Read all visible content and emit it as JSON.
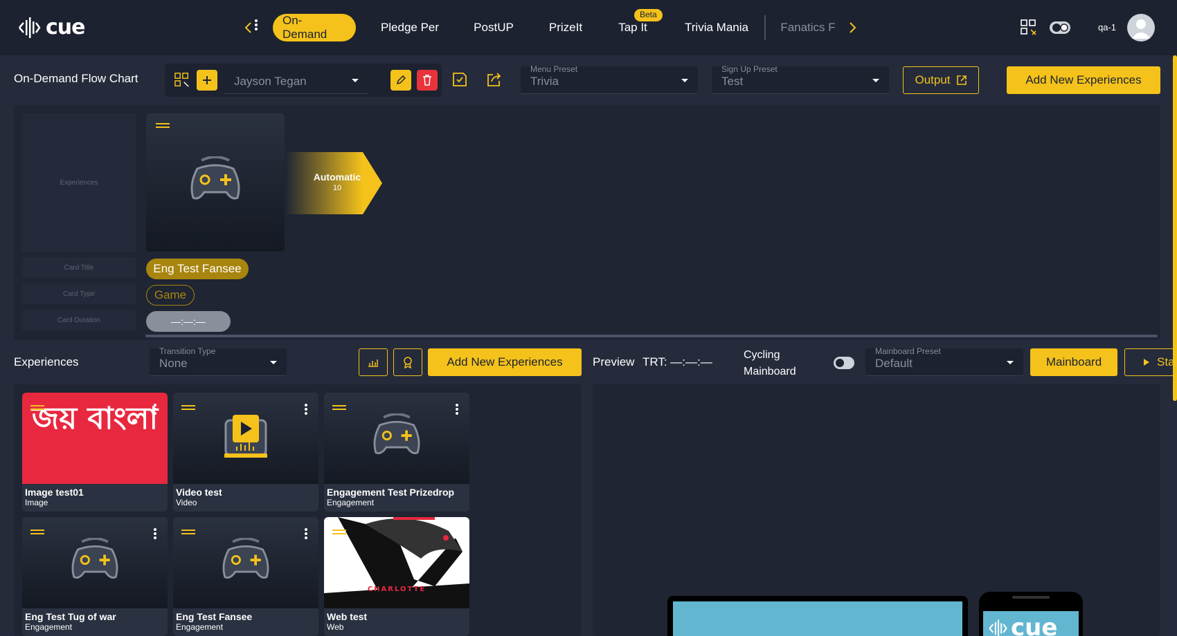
{
  "nav": {
    "logo_text": "cue",
    "tabs": [
      "On-Demand",
      "Pledge Per",
      "PostUP",
      "PrizeIt",
      "Tap It",
      "Trivia Mania",
      "Fanatics F"
    ],
    "active_tab": "On-Demand",
    "beta_badge": "Beta",
    "user": "qa-1"
  },
  "toolbar": {
    "title": "On-Demand Flow Chart",
    "flow_select": "Jayson Tegan",
    "menu_preset_label": "Menu Preset",
    "menu_preset_value": "Trivia",
    "signup_preset_label": "Sign Up Preset",
    "signup_preset_value": "Test",
    "output_label": "Output",
    "add_new_label": "Add New Experiences"
  },
  "flow": {
    "legend": [
      "Experiences",
      "Card Title",
      "Card Type",
      "Card Duration"
    ],
    "card": {
      "title": "Eng Test Fansee",
      "type": "Game",
      "duration": "—:—:—"
    },
    "transition": {
      "label": "Automatic",
      "value": "10"
    }
  },
  "experiences": {
    "title": "Experiences",
    "transition_label": "Transition Type",
    "transition_value": "None",
    "add_new_label": "Add New Experiences",
    "preview_label": "Preview",
    "trt_label": "TRT: —:—:—",
    "cycling_label": "Cycling Mainboard",
    "mainboard_preset_label": "Mainboard Preset",
    "mainboard_preset_value": "Default",
    "mainboard_label": "Mainboard",
    "start_label": "Sta",
    "cards": [
      {
        "title": "Image test01",
        "type": "Image",
        "thumb": "joy-bangla-image",
        "thumb_text": "জয় বাংলা"
      },
      {
        "title": "Video test",
        "type": "Video",
        "thumb": "video-icon"
      },
      {
        "title": "Engagement Test Prizedrop",
        "type": "Engagement",
        "thumb": "gamepad-icon"
      },
      {
        "title": "Eng Test Tug of war",
        "type": "Engagement",
        "thumb": "gamepad-icon"
      },
      {
        "title": "Eng Test Fansee",
        "type": "Engagement",
        "thumb": "gamepad-icon"
      },
      {
        "title": "Web test",
        "type": "Web",
        "thumb": "charlotte-logo",
        "thumb_text": "CHARLOTTE"
      }
    ]
  },
  "preview": {
    "phone_logo": "cue"
  },
  "colors": {
    "accent": "#f4c21b",
    "bg": "#252b3b",
    "panel": "#1f2533",
    "danger": "#e8333b"
  }
}
